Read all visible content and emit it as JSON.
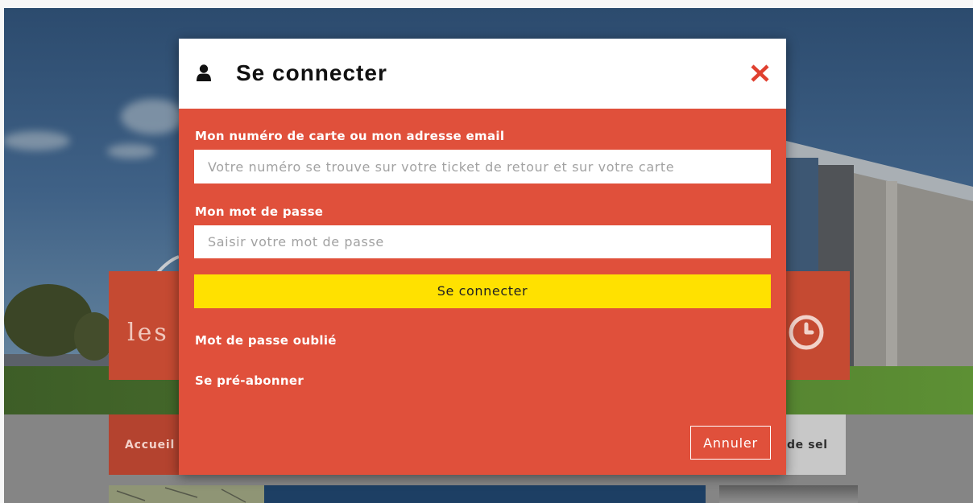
{
  "background_page": {
    "logo_text": "les",
    "nav_items": [
      "Accueil",
      "de sel"
    ]
  },
  "modal": {
    "title": "Se connecter",
    "card_field": {
      "label": "Mon numéro de carte ou mon adresse email",
      "placeholder": "Votre numéro se trouve sur votre ticket de retour et sur votre carte",
      "value": ""
    },
    "password_field": {
      "label": "Mon mot de passe",
      "placeholder": "Saisir votre mot de passe",
      "value": ""
    },
    "submit_label": "Se connecter",
    "forgot_password_link": "Mot de passe oublié",
    "pre_subscribe_link": "Se pré-abonner",
    "cancel_label": "Annuler"
  },
  "icons": {
    "header": "user-icon",
    "close": "close-icon",
    "hours_tile": "clock-icon"
  },
  "colors": {
    "modal_header": "#ffffff",
    "modal_body": "#e0503b",
    "close_icon": "#e0402f",
    "submit_button": "#ffe100",
    "submit_text": "#222222",
    "link_text": "#ffffff"
  }
}
